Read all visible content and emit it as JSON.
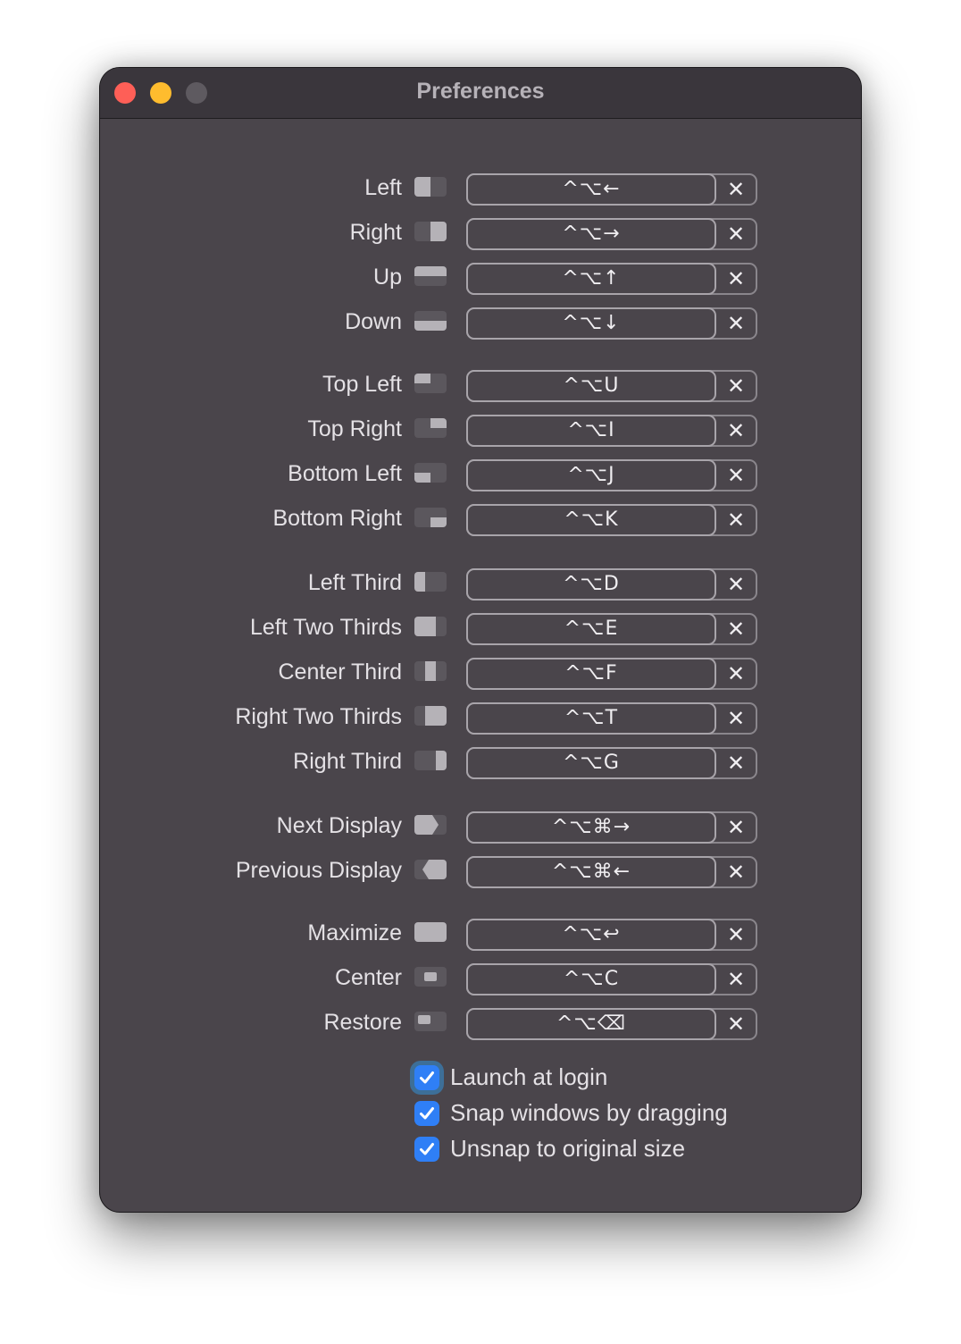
{
  "window": {
    "title": "Preferences",
    "traffic_lights": {
      "close_color": "#fe5f57",
      "minimize_color": "#febc2e",
      "zoom_color": "#5e5a60"
    }
  },
  "shortcuts": [
    {
      "label": "Left",
      "icon": "snap-left-half-icon",
      "keys": "^⌥←"
    },
    {
      "label": "Right",
      "icon": "snap-right-half-icon",
      "keys": "^⌥→"
    },
    {
      "label": "Up",
      "icon": "snap-top-half-icon",
      "keys": "^⌥↑"
    },
    {
      "label": "Down",
      "icon": "snap-bottom-half-icon",
      "keys": "^⌥↓"
    },
    {
      "label": "Top Left",
      "icon": "snap-top-left-quarter-icon",
      "keys": "^⌥U"
    },
    {
      "label": "Top Right",
      "icon": "snap-top-right-quarter-icon",
      "keys": "^⌥I"
    },
    {
      "label": "Bottom Left",
      "icon": "snap-bottom-left-quarter-icon",
      "keys": "^⌥J"
    },
    {
      "label": "Bottom Right",
      "icon": "snap-bottom-right-quarter-icon",
      "keys": "^⌥K"
    },
    {
      "label": "Left Third",
      "icon": "snap-left-third-icon",
      "keys": "^⌥D"
    },
    {
      "label": "Left Two Thirds",
      "icon": "snap-left-two-thirds-icon",
      "keys": "^⌥E"
    },
    {
      "label": "Center Third",
      "icon": "snap-center-third-icon",
      "keys": "^⌥F"
    },
    {
      "label": "Right Two Thirds",
      "icon": "snap-right-two-thirds-icon",
      "keys": "^⌥T"
    },
    {
      "label": "Right Third",
      "icon": "snap-right-third-icon",
      "keys": "^⌥G"
    },
    {
      "label": "Next Display",
      "icon": "next-display-icon",
      "keys": "^⌥⌘→"
    },
    {
      "label": "Previous Display",
      "icon": "previous-display-icon",
      "keys": "^⌥⌘←"
    },
    {
      "label": "Maximize",
      "icon": "maximize-icon",
      "keys": "^⌥↩"
    },
    {
      "label": "Center",
      "icon": "center-window-icon",
      "keys": "^⌥C"
    },
    {
      "label": "Restore",
      "icon": "restore-window-icon",
      "keys": "^⌥⌫"
    }
  ],
  "clear_glyph": "✕",
  "options": [
    {
      "label": "Launch at login",
      "checked": true,
      "focused": true
    },
    {
      "label": "Snap windows by dragging",
      "checked": true,
      "focused": false
    },
    {
      "label": "Unsnap to original size",
      "checked": true,
      "focused": false
    }
  ],
  "colors": {
    "window_bg": "#4a454b",
    "titlebar_bg": "#3a363c",
    "checkbox_accent": "#2f7ff6",
    "icon_fill": "#b5b2b7",
    "icon_bg": "#5b575d"
  }
}
